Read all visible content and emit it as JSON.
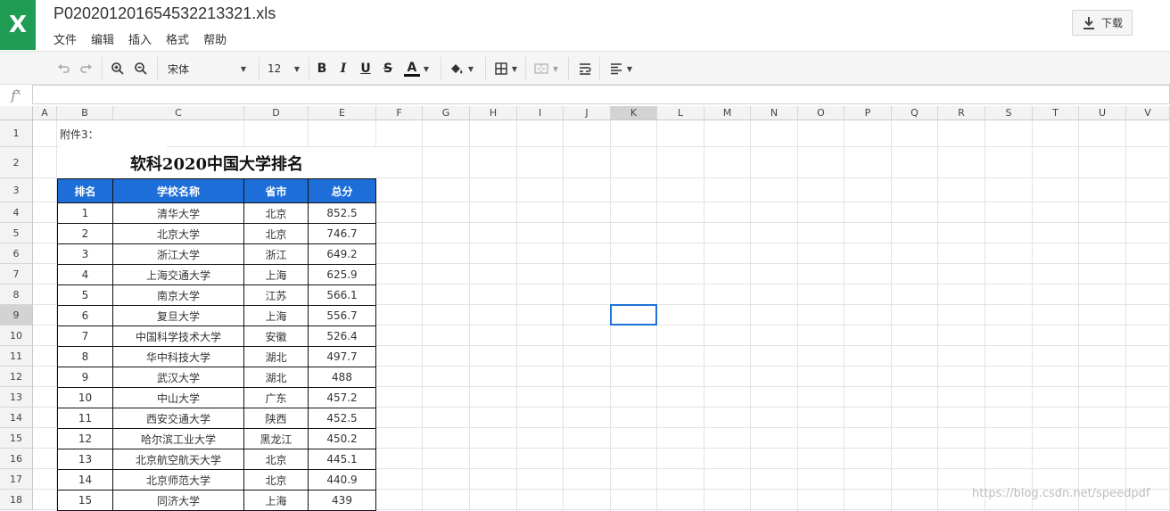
{
  "app": {
    "logo_letter": "X",
    "file_name": "P020201201654532213321.xls",
    "download_label": "下载"
  },
  "menu": [
    "文件",
    "编辑",
    "插入",
    "格式",
    "帮助"
  ],
  "toolbar": {
    "font_name": "宋体",
    "font_size": "12",
    "bold": "B",
    "italic": "I",
    "underline": "U",
    "strike": "S",
    "font_color_letter": "A"
  },
  "formula_bar": {
    "fx_label": "fx",
    "value": ""
  },
  "grid": {
    "columns": [
      "A",
      "B",
      "C",
      "D",
      "E",
      "F",
      "G",
      "H",
      "I",
      "J",
      "K",
      "L",
      "M",
      "N",
      "O",
      "P",
      "Q",
      "R",
      "S",
      "T",
      "U",
      "V"
    ],
    "rows": [
      "1",
      "2",
      "3",
      "4",
      "5",
      "6",
      "7",
      "8",
      "9",
      "10",
      "11",
      "12",
      "13",
      "14",
      "15",
      "16",
      "17",
      "18"
    ],
    "selected_cell": "K9"
  },
  "sheet": {
    "a1_note": "附件3：",
    "title": "软科2020中国大学排名",
    "headers": [
      "排名",
      "学校名称",
      "省市",
      "总分"
    ],
    "rows": [
      [
        "1",
        "清华大学",
        "北京",
        "852.5"
      ],
      [
        "2",
        "北京大学",
        "北京",
        "746.7"
      ],
      [
        "3",
        "浙江大学",
        "浙江",
        "649.2"
      ],
      [
        "4",
        "上海交通大学",
        "上海",
        "625.9"
      ],
      [
        "5",
        "南京大学",
        "江苏",
        "566.1"
      ],
      [
        "6",
        "复旦大学",
        "上海",
        "556.7"
      ],
      [
        "7",
        "中国科学技术大学",
        "安徽",
        "526.4"
      ],
      [
        "8",
        "华中科技大学",
        "湖北",
        "497.7"
      ],
      [
        "9",
        "武汉大学",
        "湖北",
        "488"
      ],
      [
        "10",
        "中山大学",
        "广东",
        "457.2"
      ],
      [
        "11",
        "西安交通大学",
        "陕西",
        "452.5"
      ],
      [
        "12",
        "哈尔滨工业大学",
        "黑龙江",
        "450.2"
      ],
      [
        "13",
        "北京航空航天大学",
        "北京",
        "445.1"
      ],
      [
        "14",
        "北京师范大学",
        "北京",
        "440.9"
      ],
      [
        "15",
        "同济大学",
        "上海",
        "439"
      ]
    ]
  },
  "watermark": "https://blog.csdn.net/speedpdf",
  "colors": {
    "brand": "#1f9d55",
    "header_fill": "#1d6ed8",
    "selection": "#1d74d8"
  }
}
